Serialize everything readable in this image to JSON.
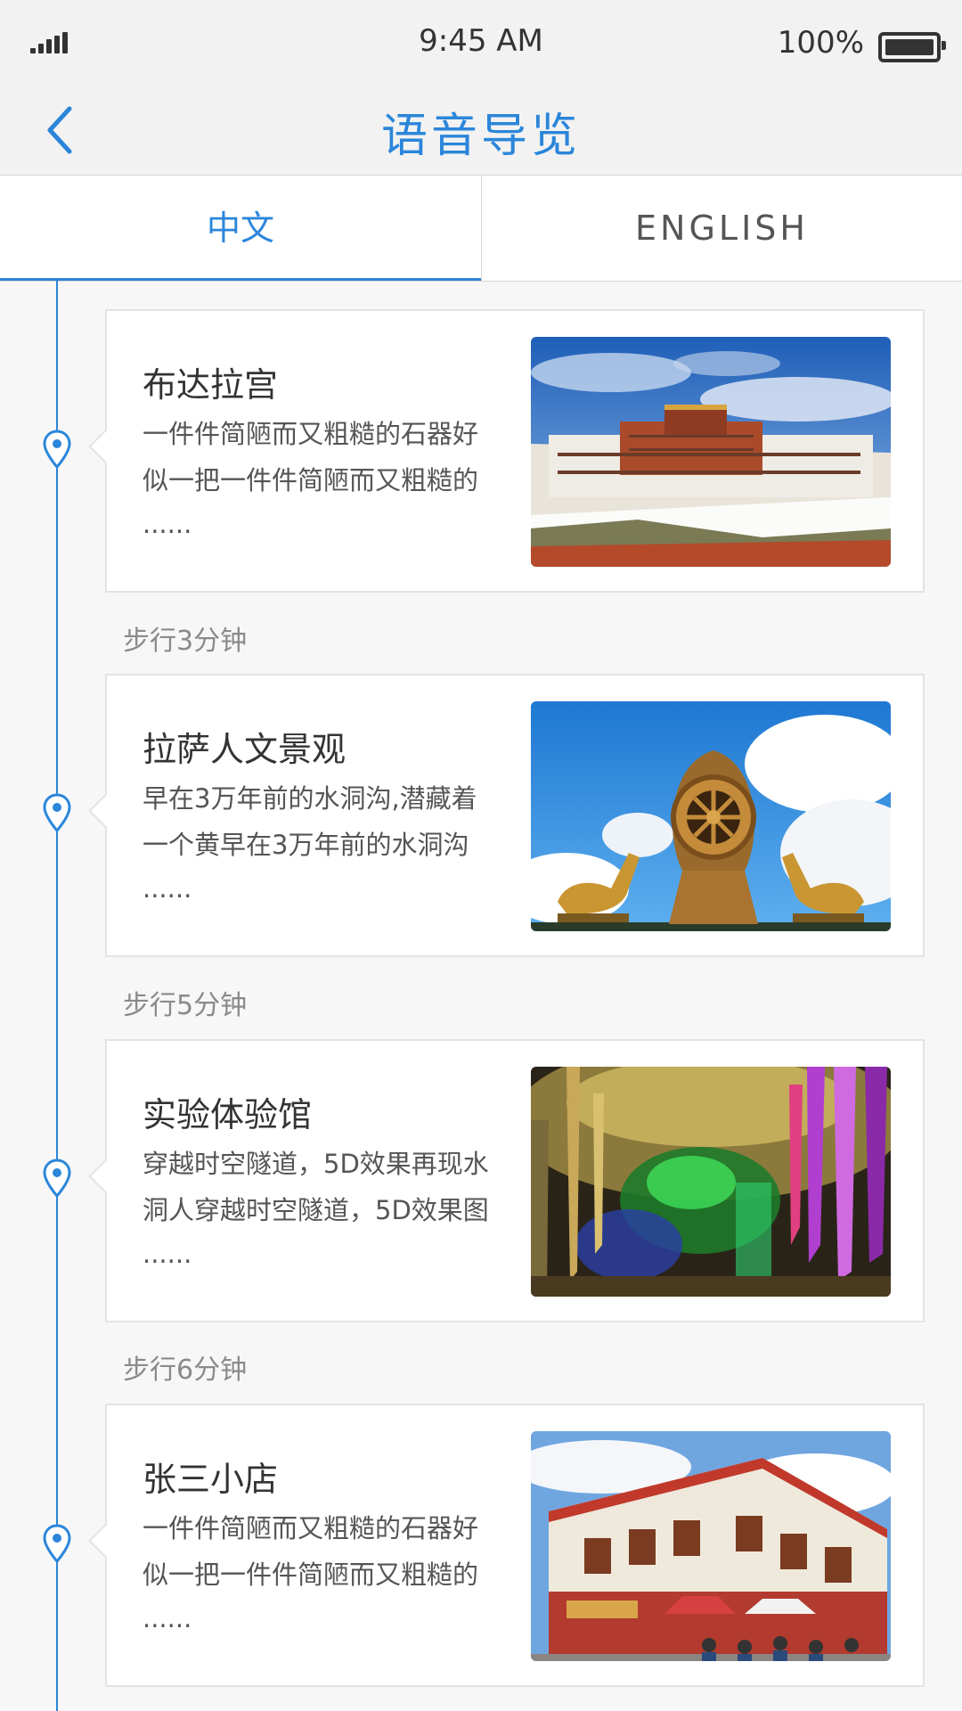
{
  "status_bar": {
    "time": "9:45 AM",
    "battery": "100%"
  },
  "nav": {
    "title": "语音导览"
  },
  "tabs": [
    {
      "label": "中文",
      "active": true
    },
    {
      "label": "ENGLISH",
      "active": false
    }
  ],
  "colors": {
    "accent": "#2b86da",
    "background": "#f7f7f7",
    "card": "#ffffff"
  },
  "stops": [
    {
      "title": "布达拉宫",
      "desc": "一件件简陋而又粗糙的石器好似一把一件件简陋而又粗糙的",
      "more": "......",
      "image": "potala-palace-photo"
    },
    {
      "title": "拉萨人文景观",
      "desc": "早在3万年前的水洞沟,潜藏着一个黄早在3万年前的水洞沟",
      "more": "......",
      "image": "dharma-wheel-deer-photo"
    },
    {
      "title": "实验体验馆",
      "desc": "穿越时空隧道，5D效果再现水洞人穿越时空隧道，5D效果图",
      "more": "......",
      "image": "illuminated-cave-photo"
    },
    {
      "title": "张三小店",
      "desc": "一件件简陋而又粗糙的石器好似一把一件件简陋而又粗糙的",
      "more": "......",
      "image": "tibetan-shop-street-photo"
    }
  ],
  "walks": [
    "步行3分钟",
    "步行5分钟",
    "步行6分钟"
  ]
}
